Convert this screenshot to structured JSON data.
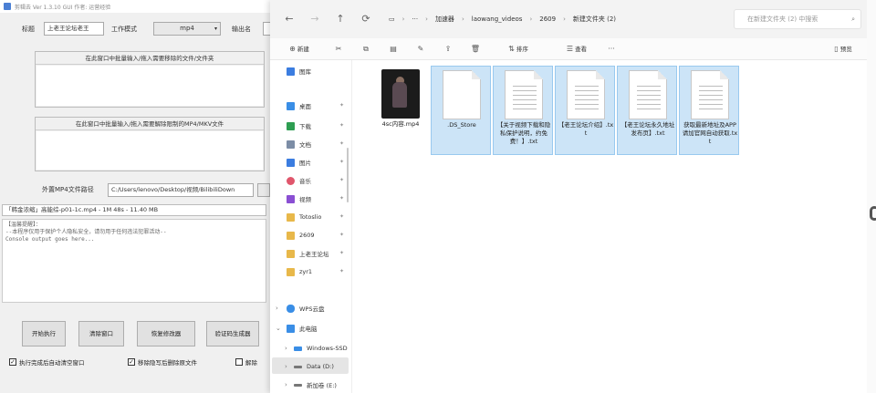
{
  "app": {
    "title": "剪辑去 Ver 1.3.10 GUI 作者: 运营经验",
    "label_title": "标题",
    "title_value": "上老王论坛老王",
    "label_mode": "工作模式",
    "mode_value": "mp4",
    "label_output": "输出名",
    "group1_header": "在此窗口中批量输入/拖入需要移除的文件/文件夹",
    "group2_header": "在此窗口中批量输入/拖入需要解除限制的MP4/MKV文件",
    "label_path": "外置MP4文件路径",
    "path_value": "C:/Users/lenovo/Desktop/视频/BilibiliDown",
    "status_text": "「韩金浓缩」高能综-p01-1c.mp4 - 1M 48s - 11.40 MB",
    "console_lines": [
      "【温馨提醒】：",
      "--本程序仅用于保护个人隐私安全，请勿用于任何违法犯罪活动--",
      "Console output goes here..."
    ],
    "btn_start": "开始执行",
    "btn_clear": "清除窗口",
    "btn_restore": "恢复修改器",
    "btn_verify": "验证码生成器",
    "chk1_label": "执行完成后自动清空窗口",
    "chk2_label": "移除隐写后删除原文件",
    "chk3_label": "解除"
  },
  "explorer": {
    "nav": {
      "back": "←",
      "forward": "→",
      "up": "↑",
      "refresh": "⟳"
    },
    "breadcrumb": [
      "加速器",
      "laowang_videos",
      "2609",
      "新建文件夹 (2)"
    ],
    "search_placeholder": "在新建文件夹 (2) 中搜索",
    "toolbar": {
      "new_label": "新建",
      "sort_label": "排序",
      "view_label": "查看",
      "details_label": "预览"
    },
    "sidebar": [
      {
        "label": "图库",
        "color": "#3b7de0"
      },
      {
        "label": "桌面",
        "color": "#3a8ee6"
      },
      {
        "label": "下载",
        "color": "#2e9e52"
      },
      {
        "label": "文档",
        "color": "#7c8da6"
      },
      {
        "label": "图片",
        "color": "#3b7de0"
      },
      {
        "label": "音乐",
        "color": "#e0566c"
      },
      {
        "label": "视频",
        "color": "#8a4fd3"
      },
      {
        "label": "Totoslio",
        "color": "#e8b84a"
      },
      {
        "label": "2609",
        "color": "#e8b84a"
      },
      {
        "label": "上老王论坛",
        "color": "#e8b84a"
      },
      {
        "label": "zyr1",
        "color": "#e8b84a"
      },
      {
        "label": "WPS云盘",
        "color": "#3a8ee6"
      },
      {
        "label": "此电脑",
        "color": "#3a8ee6"
      },
      {
        "label": "Windows-SSD",
        "color": "#3a8ee6"
      },
      {
        "label": "Data (D:)",
        "color": "#777777"
      },
      {
        "label": "新加卷 (E:)",
        "color": "#777777"
      }
    ],
    "files": [
      {
        "name": "4sc内容.mp4",
        "kind": "video",
        "selected": false
      },
      {
        "name": ".DS_Store",
        "kind": "doc",
        "selected": true
      },
      {
        "name": "【关于视频下载和隐私保护说明，约免费！】.txt",
        "kind": "doc",
        "selected": true
      },
      {
        "name": "【老王论坛介绍】.txt",
        "kind": "doc",
        "selected": true
      },
      {
        "name": "【老王论坛永久地址发布页】.txt",
        "kind": "doc",
        "selected": true
      },
      {
        "name": "获取最新地址及APP请加官网自动获取.txt",
        "kind": "doc",
        "selected": true
      }
    ]
  }
}
